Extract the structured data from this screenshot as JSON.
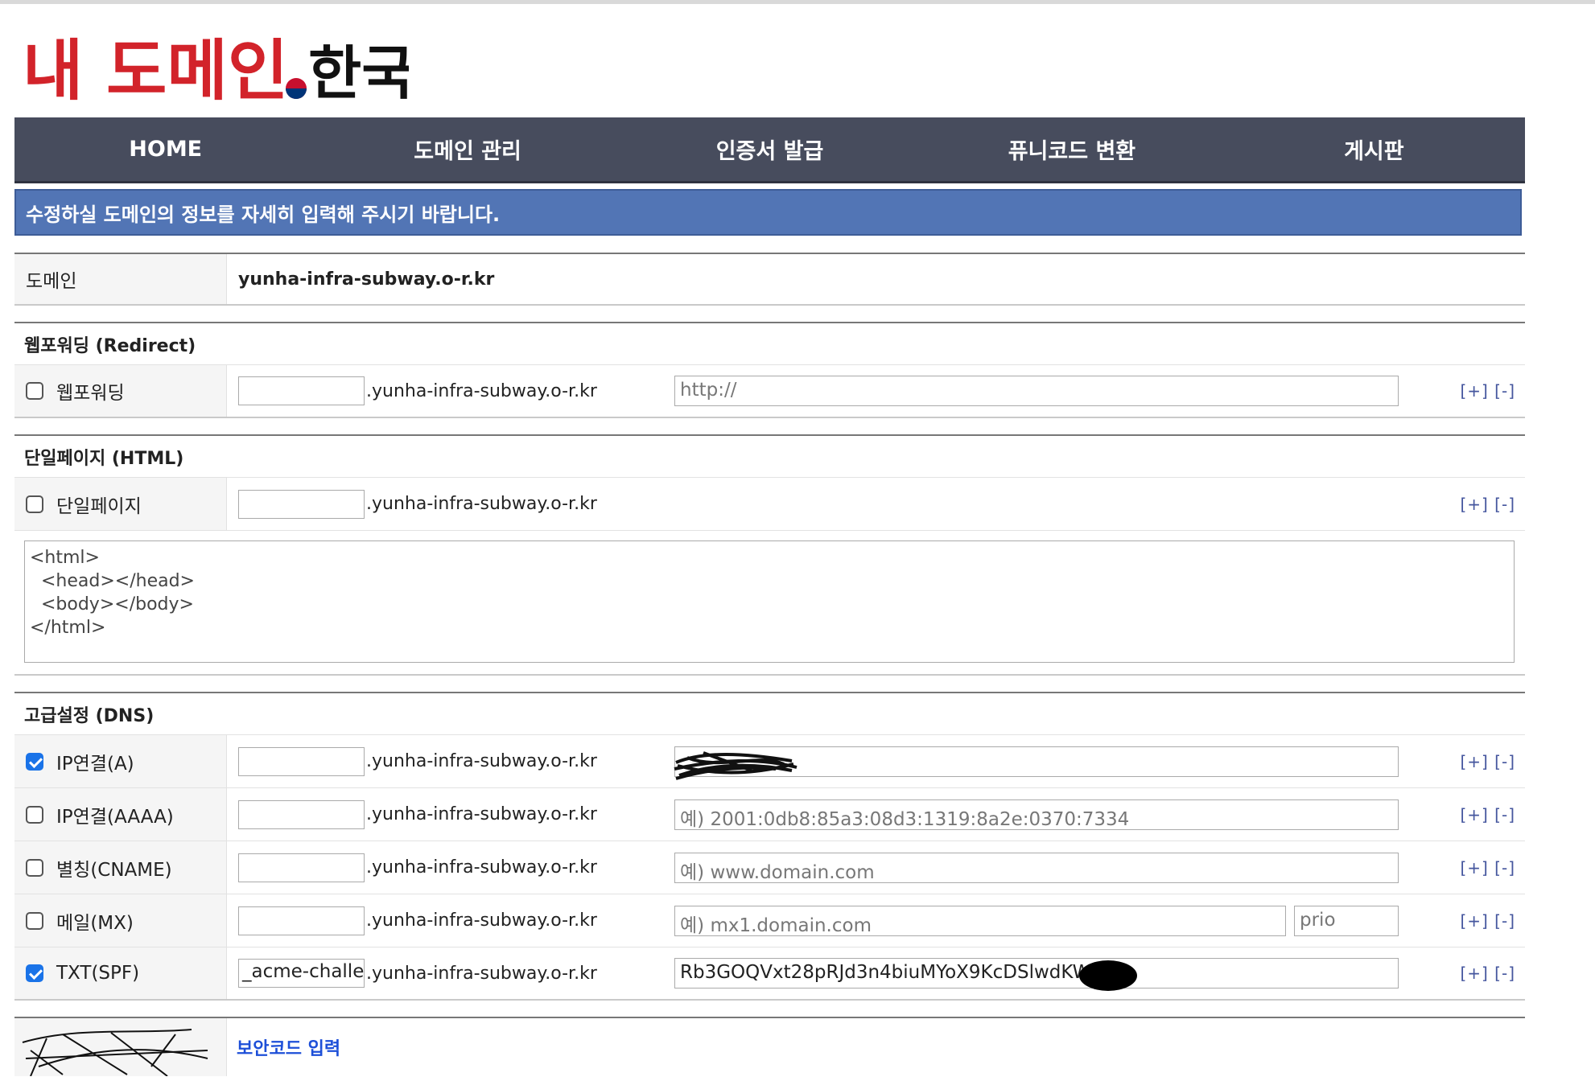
{
  "logo": {
    "text_main": "내 도메인",
    "text_dot": ".",
    "text_suffix": "한국"
  },
  "nav": [
    {
      "label": "HOME"
    },
    {
      "label": "도메인 관리"
    },
    {
      "label": "인증서 발급"
    },
    {
      "label": "퓨니코드 변환"
    },
    {
      "label": "게시판"
    }
  ],
  "banner": "수정하실 도메인의 정보를 자세히 입력해 주시기 바랍니다.",
  "domain_row": {
    "label": "도메인",
    "value": "yunha-infra-subway.o-r.kr"
  },
  "domain_suffix": ".yunha-infra-subway.o-r.kr",
  "plus_minus": "[+] [-]",
  "redirect": {
    "heading": "웹포워딩 (Redirect)",
    "label": "웹포워딩",
    "checked": false,
    "sub_value": "",
    "url_placeholder": "http://"
  },
  "html_page": {
    "heading": "단일페이지 (HTML)",
    "label": "단일페이지",
    "checked": false,
    "sub_value": "",
    "code": "<html>\n  <head></head>\n  <body></body>\n</html>"
  },
  "dns": {
    "heading": "고급설정 (DNS)",
    "records": [
      {
        "label": "IP연결(A)",
        "checked": true,
        "sub": "",
        "value": "",
        "placeholder": ""
      },
      {
        "label": "IP연결(AAAA)",
        "checked": false,
        "sub": "",
        "value": "",
        "placeholder": "예) 2001:0db8:85a3:08d3:1319:8a2e:0370:7334"
      },
      {
        "label": "별칭(CNAME)",
        "checked": false,
        "sub": "",
        "value": "",
        "placeholder": "예) www.domain.com"
      },
      {
        "label": "메일(MX)",
        "checked": false,
        "sub": "",
        "value": "",
        "placeholder": "예) mx1.domain.com",
        "prio_placeholder": "prio"
      },
      {
        "label": "TXT(SPF)",
        "checked": true,
        "sub": "_acme-challen",
        "value": "Rb3GOQVxt28pRJd3n4biuMYoX9KcDSlwdKWB1L",
        "placeholder": ""
      }
    ]
  },
  "captcha": {
    "label": "보안코드 입력"
  },
  "colors": {
    "nav_bg": "#474c5d",
    "banner_bg": "#5275b5",
    "link": "#45569e",
    "check": "#1a73e8"
  }
}
